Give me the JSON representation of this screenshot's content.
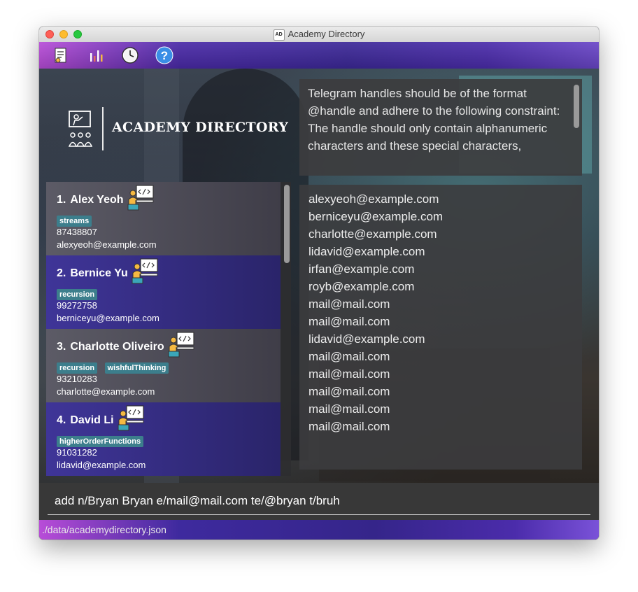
{
  "window": {
    "title": "Academy Directory",
    "app_icon_text": "AD"
  },
  "menubar": {
    "icons": [
      "student-list-icon",
      "chart-icon",
      "history-icon",
      "help-icon"
    ]
  },
  "logo": {
    "text": "ACADEMY DIRECTORY",
    "icon": "classroom-icon"
  },
  "result_display": {
    "text": "Telegram handles should be of the format @handle and adhere to the following constraint:\nThe handle should only contain alphanumeric characters and these special characters,"
  },
  "students": [
    {
      "index": "1.",
      "name": "Alex Yeoh",
      "tags": [
        "streams"
      ],
      "phone": "87438807",
      "email": "alexyeoh@example.com"
    },
    {
      "index": "2.",
      "name": "Bernice Yu",
      "tags": [
        "recursion"
      ],
      "phone": "99272758",
      "email": "berniceyu@example.com"
    },
    {
      "index": "3.",
      "name": "Charlotte Oliveiro",
      "tags": [
        "recursion",
        "wishfulThinking"
      ],
      "phone": "93210283",
      "email": "charlotte@example.com"
    },
    {
      "index": "4.",
      "name": "David Li",
      "tags": [
        "higherOrderFunctions"
      ],
      "phone": "91031282",
      "email": "lidavid@example.com"
    }
  ],
  "output_list": [
    "alexyeoh@example.com",
    "berniceyu@example.com",
    "charlotte@example.com",
    "lidavid@example.com",
    "irfan@example.com",
    "royb@example.com",
    "mail@mail.com",
    "mail@mail.com",
    "lidavid@example.com",
    "mail@mail.com",
    "mail@mail.com",
    "mail@mail.com",
    "mail@mail.com",
    "mail@mail.com"
  ],
  "command_box": {
    "value": "add n/Bryan Bryan e/mail@mail.com te/@bryan t/bruh"
  },
  "status_bar": {
    "path": "./data/academydirectory.json"
  },
  "colors": {
    "tag_bg": "#3c7e8c",
    "card_odd": "#4d4c57",
    "card_even": "#3a3190",
    "accent": "#4a2aa8"
  }
}
